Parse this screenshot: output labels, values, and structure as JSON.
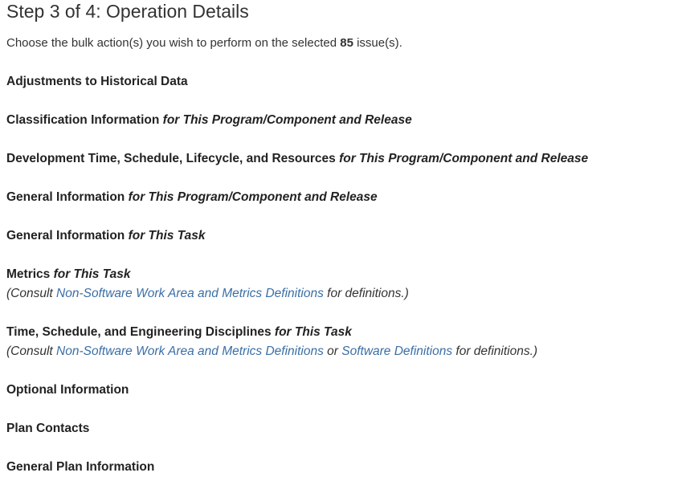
{
  "header": {
    "title": "Step 3 of 4: Operation Details"
  },
  "intro": {
    "prefix": "Choose the bulk action(s) you wish to perform on the selected",
    "count": "85",
    "suffix": "issue(s)."
  },
  "sections": {
    "historical": {
      "label": "Adjustments to Historical Data"
    },
    "classification": {
      "label": "Classification Information",
      "qualifier": "for This Program/Component and Release"
    },
    "development": {
      "label": "Development Time, Schedule, Lifecycle, and Resources",
      "qualifier": "for This Program/Component and Release"
    },
    "general_program": {
      "label": "General Information",
      "qualifier": "for This Program/Component and Release"
    },
    "general_task": {
      "label": "General Information",
      "qualifier": "for This Task"
    },
    "metrics": {
      "label": "Metrics",
      "qualifier": "for This Task",
      "consult_prefix": "(Consult",
      "link1": "Non-Software Work Area and Metrics Definitions",
      "consult_suffix": "for definitions.)"
    },
    "time_schedule": {
      "label": "Time, Schedule, and Engineering Disciplines",
      "qualifier": "for This Task",
      "consult_prefix": "(Consult",
      "link1": "Non-Software Work Area and Metrics Definitions",
      "connector": "or",
      "link2": "Software Definitions",
      "consult_suffix": "for definitions.)"
    },
    "optional": {
      "label": "Optional Information"
    },
    "plan_contacts": {
      "label": "Plan Contacts"
    },
    "general_plan": {
      "label": "General Plan Information"
    }
  },
  "colors": {
    "text": "#333333",
    "heading": "#222222",
    "link": "#3a6ea5"
  }
}
